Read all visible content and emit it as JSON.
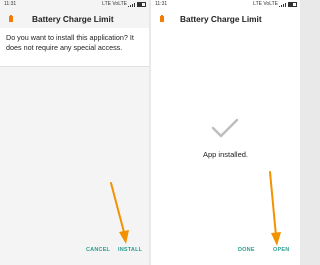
{
  "left": {
    "status_time": "11:31",
    "network": "LTE VoLTE",
    "app_title": "Battery Charge Limit",
    "message": "Do you want to install this application? It does not require any special access.",
    "cancel_label": "CANCEL",
    "install_label": "INSTALL"
  },
  "right": {
    "status_time": "11:31",
    "network": "LTE VoLTE",
    "app_title": "Battery Charge Limit",
    "installed_message": "App installed.",
    "done_label": "DONE",
    "open_label": "OPEN"
  },
  "colors": {
    "accent_teal": "#2a9d8f",
    "arrow_orange": "#f39200",
    "app_icon_orange": "#f57c00",
    "check_gray": "#bdbdbd"
  },
  "icons": [
    "app-icon",
    "signal-icon",
    "battery-icon",
    "checkmark-icon",
    "arrow-icon"
  ]
}
